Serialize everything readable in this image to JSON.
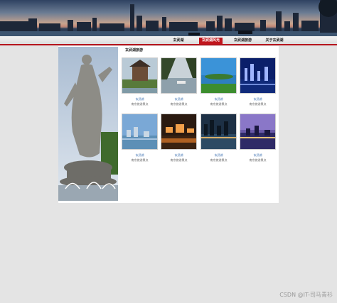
{
  "nav": {
    "items": [
      "玄武湖",
      "玄武湖风光",
      "玄武湖旅游",
      "关于玄武湖"
    ],
    "active_index": 1
  },
  "section": {
    "title": "玄武湖旅游"
  },
  "gallery": [
    {
      "caption": "玄武湖",
      "desc": "南京旅游景点"
    },
    {
      "caption": "玄武湖",
      "desc": "南京旅游景点"
    },
    {
      "caption": "玄武湖",
      "desc": "南京旅游景点"
    },
    {
      "caption": "玄武湖",
      "desc": "南京旅游景点"
    },
    {
      "caption": "玄武湖",
      "desc": "南京旅游景点"
    },
    {
      "caption": "玄武湖",
      "desc": "南京旅游景点"
    },
    {
      "caption": "玄武湖",
      "desc": "南京旅游景点"
    },
    {
      "caption": "玄武湖",
      "desc": "南京旅游景点"
    }
  ],
  "watermark": "CSDN @IT-司马青衫",
  "colors": {
    "accent": "#c0161d",
    "background": "#e4e4e4"
  }
}
